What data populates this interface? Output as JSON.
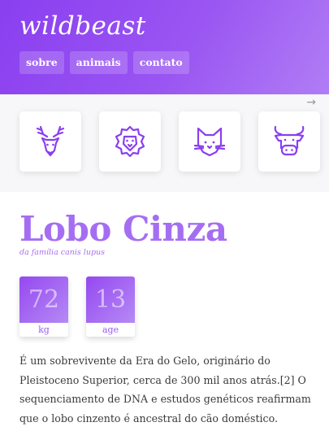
{
  "header": {
    "brand": "wildbeast",
    "nav": [
      {
        "label": "sobre"
      },
      {
        "label": "animais"
      },
      {
        "label": "contato"
      }
    ]
  },
  "animals": {
    "scroll_arrow": "→",
    "tiles": [
      {
        "icon": "deer-icon"
      },
      {
        "icon": "lion-icon"
      },
      {
        "icon": "cat-icon"
      },
      {
        "icon": "bull-icon"
      }
    ]
  },
  "main": {
    "title": "Lobo Cinza",
    "subtitle": "da família canis lupus",
    "stats": [
      {
        "value": "72",
        "unit": "kg"
      },
      {
        "value": "13",
        "unit": "age"
      }
    ],
    "description": "É um sobrevivente da Era do Gelo, originário do Pleistoceno Superior, cerca de 300 mil anos atrás.[2] O sequenciamento de DNA e estudos genéticos reafirmam que o lobo cinzento é ancestral do cão doméstico."
  },
  "colors": {
    "accent": "#8a3ff0",
    "title": "#a56ef2",
    "background_strip": "#f7f6f9"
  }
}
